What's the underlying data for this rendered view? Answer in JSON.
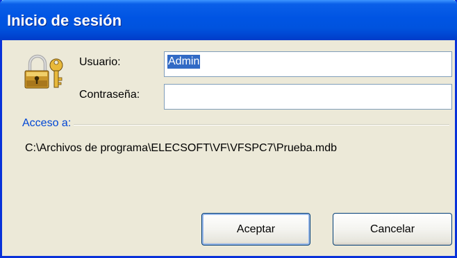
{
  "window": {
    "title": "Inicio de sesión"
  },
  "form": {
    "user_label": "Usuario:",
    "user_value": "Admin",
    "password_label": "Contraseña:",
    "password_value": ""
  },
  "access": {
    "label": "Acceso a:",
    "path": "C:\\Archivos de programa\\ELECSOFT\\VF\\VFSPC7\\Prueba.mdb"
  },
  "buttons": {
    "ok": "Aceptar",
    "cancel": "Cancelar"
  },
  "icons": {
    "dialog": "padlock-key-icon"
  },
  "colors": {
    "titlebar": "#0054e3",
    "group_label": "#0046d5",
    "selection": "#316ac5",
    "dialog_bg": "#ece9d8"
  }
}
